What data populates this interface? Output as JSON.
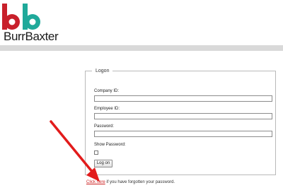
{
  "brand": {
    "name": "BurrBaxter",
    "logo_icon": "bb-logo-icon",
    "red": "#c8202b",
    "teal": "#1fa99a"
  },
  "logon": {
    "legend": "Logon",
    "company_id_label": "Company ID:",
    "employee_id_label": "Employee ID:",
    "password_label": "Password:",
    "show_password_label": "Show Password:",
    "show_password_checked": false,
    "submit_label": "Log on"
  },
  "forgot": {
    "link_text": "Click here",
    "suffix_text": " if you have forgotten your password."
  },
  "annotation": {
    "icon": "red-arrow-annotation",
    "color": "#e21b1b"
  }
}
